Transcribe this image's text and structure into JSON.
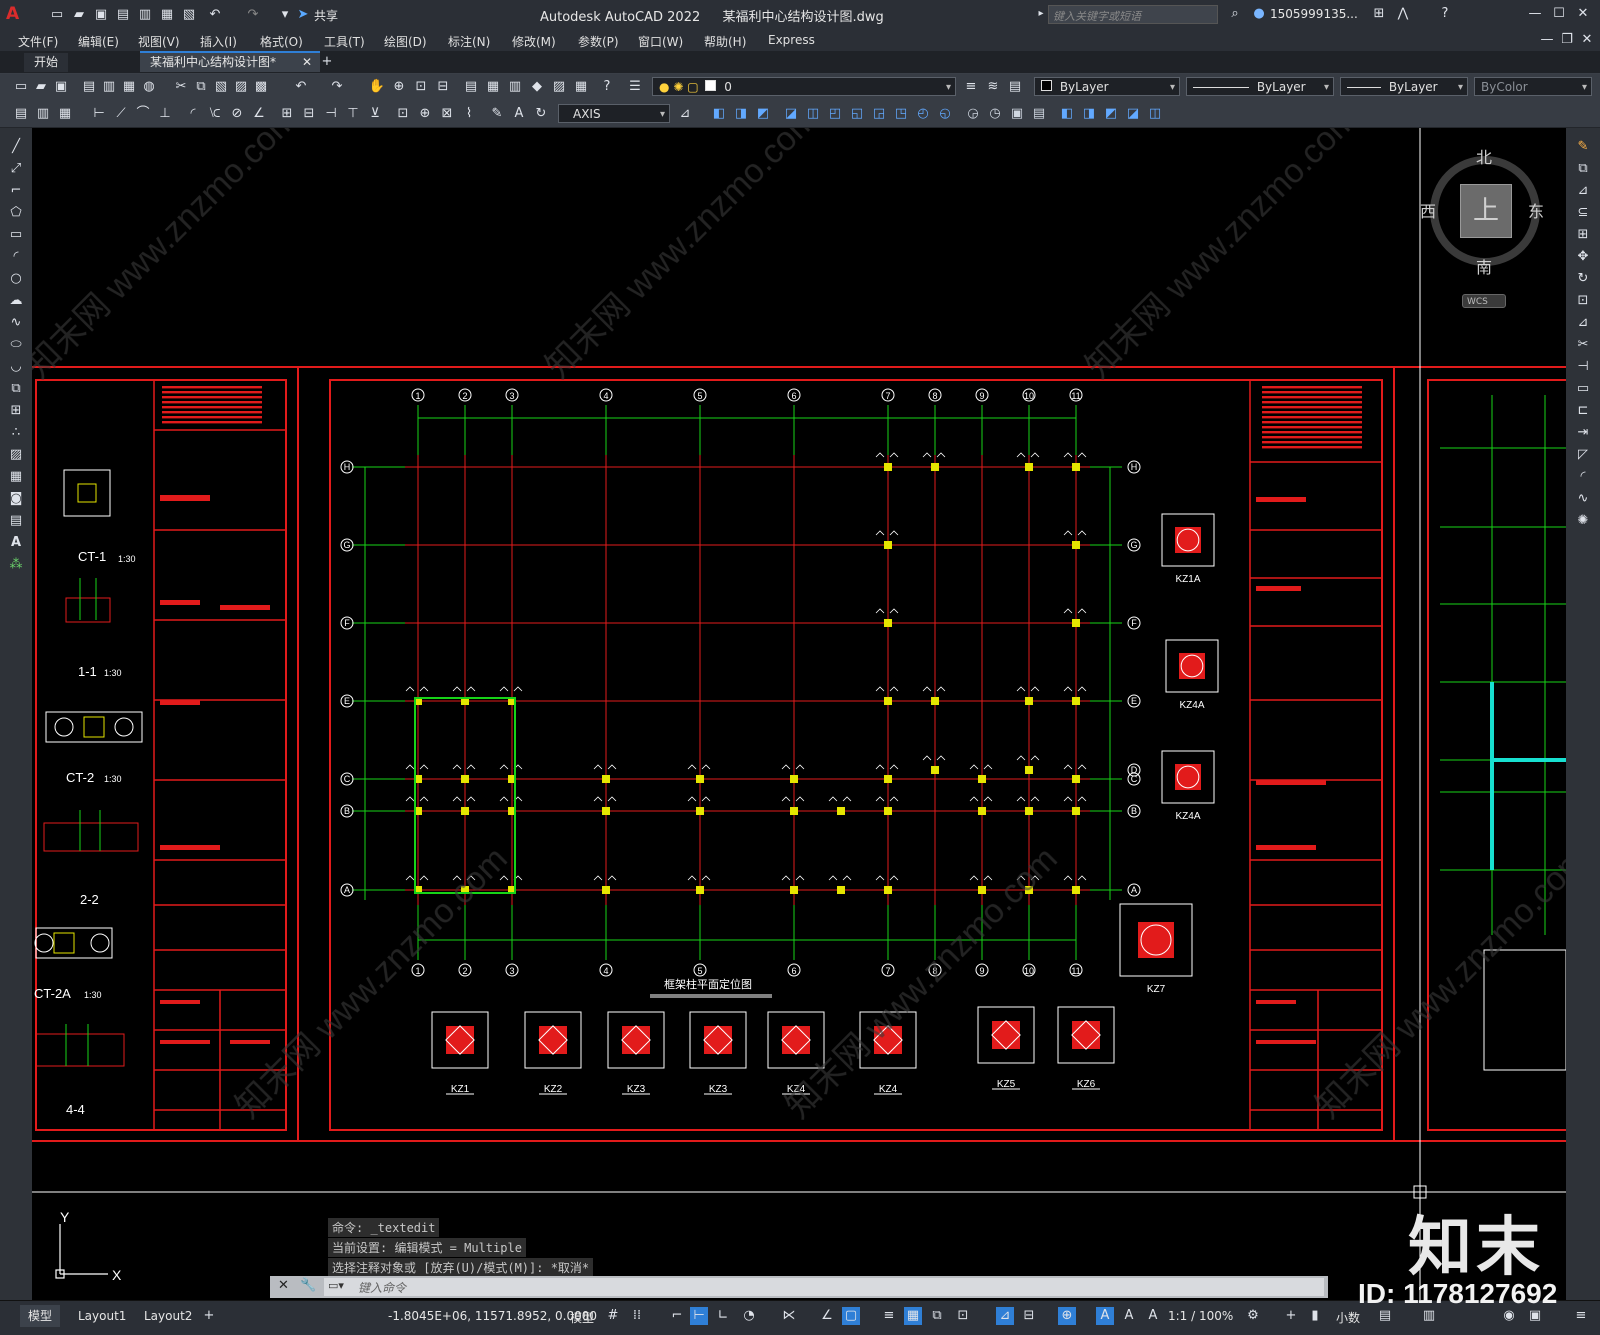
{
  "app": {
    "title": "Autodesk AutoCAD 2022",
    "filename": "某福利中心结构设计图.dwg",
    "share": "共享",
    "search_placeholder": "键入关键字或短语",
    "user": "1505999135..."
  },
  "menu": [
    "文件(F)",
    "编辑(E)",
    "视图(V)",
    "插入(I)",
    "格式(O)",
    "工具(T)",
    "绘图(D)",
    "标注(N)",
    "修改(M)",
    "参数(P)",
    "窗口(W)",
    "帮助(H)",
    "Express"
  ],
  "tabs": {
    "start": "开始",
    "active": "某福利中心结构设计图*"
  },
  "toolbar": {
    "layer_value": "0",
    "color": "ByLayer",
    "linetype": "ByLayer",
    "lineweight": "ByLayer",
    "plotstyle": "ByColor",
    "dimstyle": "AXIS"
  },
  "viewcube": {
    "n": "北",
    "s": "南",
    "e": "东",
    "w": "西",
    "top": "上",
    "wcs": "WCS"
  },
  "drawing": {
    "plan_title": "框架柱平面定位图",
    "axis_numbers": [
      "1",
      "2",
      "3",
      "4",
      "5",
      "6",
      "7",
      "8",
      "9",
      "10",
      "11"
    ],
    "axis_letters": [
      "H",
      "G",
      "F",
      "E",
      "D",
      "C",
      "B",
      "A"
    ],
    "column_labels": [
      "KZ1",
      "KZ2",
      "KZ3",
      "KZ3",
      "KZ4",
      "KZ4",
      "KZ5",
      "KZ6"
    ],
    "side_labels": [
      "KZ1A",
      "KZ4A",
      "KZ4A",
      "KZ7"
    ],
    "left_sections": [
      {
        "name": "CT-1",
        "scale": "1:30"
      },
      {
        "name": "1-1",
        "scale": "1:30"
      },
      {
        "name": "CT-2",
        "scale": "1:30"
      },
      {
        "name": "2-2",
        "scale": ""
      },
      {
        "name": "CT-2A",
        "scale": "1:30"
      },
      {
        "name": "4-4",
        "scale": ""
      }
    ]
  },
  "command": {
    "line1": "命令: _textedit",
    "line2": "当前设置: 编辑模式 = Multiple",
    "line3": "选择注释对象或 [放弃(U)/模式(M)]: *取消*",
    "placeholder": "键入命令"
  },
  "ucs": {
    "x": "X",
    "y": "Y"
  },
  "layouts": [
    "模型",
    "Layout1",
    "Layout2"
  ],
  "status": {
    "coords": "-1.8045E+06, 11571.8952, 0.0000",
    "space": "模型",
    "scale": "1:1 / 100%",
    "units": "小数"
  },
  "watermark": {
    "brand": "知末",
    "id": "ID: 1178127692"
  },
  "colors": {
    "red": "#e21b1b",
    "green": "#17d317",
    "yellow": "#e5e500",
    "accent": "#2f7fd6"
  }
}
